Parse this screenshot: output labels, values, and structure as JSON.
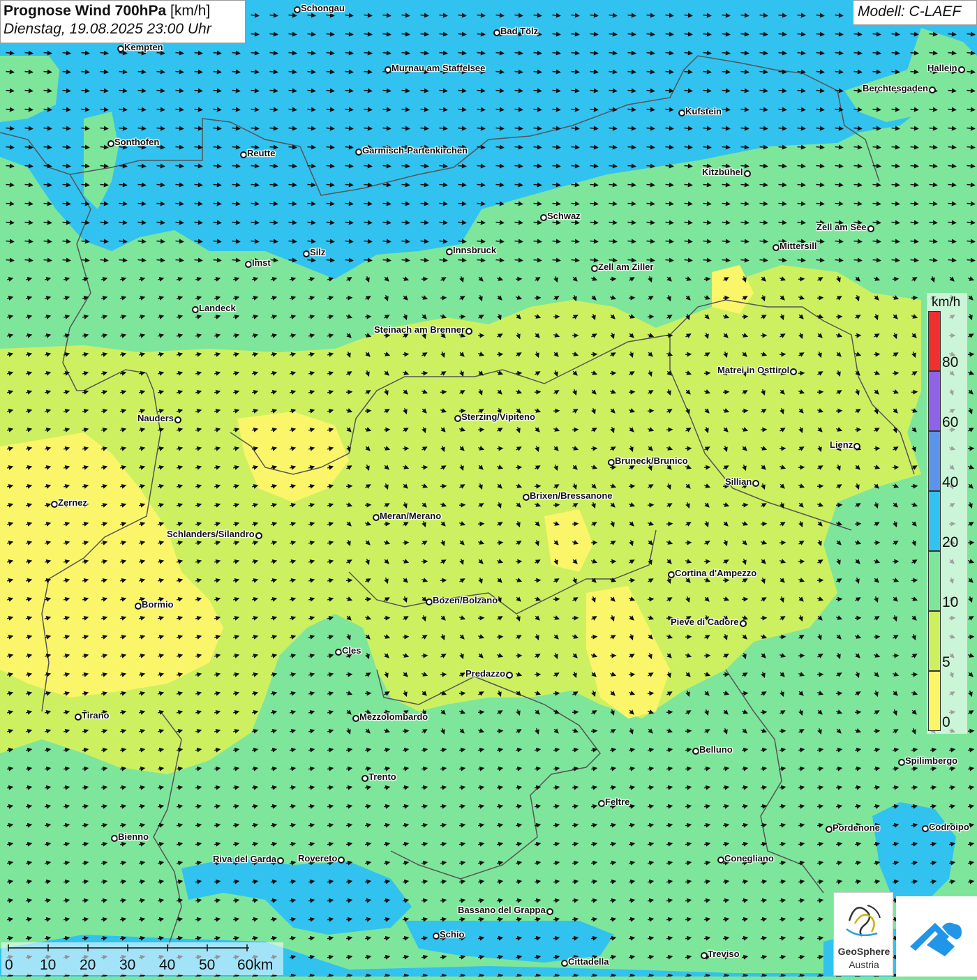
{
  "header": {
    "title_bold": "Prognose Wind 700hPa",
    "title_unit": "[km/h]",
    "datetime": "Dienstag, 19.08.2025 23:00 Uhr",
    "model": "Modell: C-LAEF"
  },
  "legend": {
    "unit": "km/h",
    "labels": [
      "80",
      "60",
      "40",
      "20",
      "10",
      "5",
      "0"
    ],
    "colors": [
      "#f0302e",
      "#8f63e8",
      "#5b94e8",
      "#31c2f0",
      "#7de69b",
      "#cdf061",
      "#fbf56a"
    ]
  },
  "scale_bar": {
    "labels": [
      "0",
      "10",
      "20",
      "30",
      "40",
      "50",
      "60km"
    ]
  },
  "logos": {
    "geosphere_line1": "GeoSphere",
    "geosphere_line2": "Austria"
  },
  "cities": [
    {
      "name": "Schongau"
    },
    {
      "name": "Kempten"
    },
    {
      "name": "Bad Tölz"
    },
    {
      "name": "Murnau am Staffelsee"
    },
    {
      "name": "Hallein"
    },
    {
      "name": "Berchtesgaden"
    },
    {
      "name": "Kufstein"
    },
    {
      "name": "Sonthofen"
    },
    {
      "name": "Reutte"
    },
    {
      "name": "Garmisch-Partenkirchen"
    },
    {
      "name": "Kitzbühel"
    },
    {
      "name": "Schwaz"
    },
    {
      "name": "Zell am See"
    },
    {
      "name": "Mittersill"
    },
    {
      "name": "Innsbruck"
    },
    {
      "name": "Silz"
    },
    {
      "name": "Imst"
    },
    {
      "name": "Zell am Ziller"
    },
    {
      "name": "Landeck"
    },
    {
      "name": "Steinach am Brenner"
    },
    {
      "name": "Matrei in Osttirol"
    },
    {
      "name": "Nauders"
    },
    {
      "name": "Sterzing/Vipiteno"
    },
    {
      "name": "Lienz"
    },
    {
      "name": "Bruneck/Brunico"
    },
    {
      "name": "Sillian"
    },
    {
      "name": "Brixen/Bressanone"
    },
    {
      "name": "Zernez"
    },
    {
      "name": "Meran/Merano"
    },
    {
      "name": "Schlanders/Silandro"
    },
    {
      "name": "Cortina d'Ampezzo"
    },
    {
      "name": "Bozen/Bolzano"
    },
    {
      "name": "Bormio"
    },
    {
      "name": "Pieve di Cadore"
    },
    {
      "name": "Cles"
    },
    {
      "name": "Predazzo"
    },
    {
      "name": "Tirano"
    },
    {
      "name": "Mezzolombardo"
    },
    {
      "name": "Belluno"
    },
    {
      "name": "Spilimbergo"
    },
    {
      "name": "Trento"
    },
    {
      "name": "Feltre"
    },
    {
      "name": "Pordenone"
    },
    {
      "name": "Codroipo"
    },
    {
      "name": "Bienno"
    },
    {
      "name": "Riva del Garda"
    },
    {
      "name": "Rovereto"
    },
    {
      "name": "Conegliano"
    },
    {
      "name": "Bassano del Grappa"
    },
    {
      "name": "Schio"
    },
    {
      "name": "Treviso"
    },
    {
      "name": "Cittadella"
    }
  ]
}
